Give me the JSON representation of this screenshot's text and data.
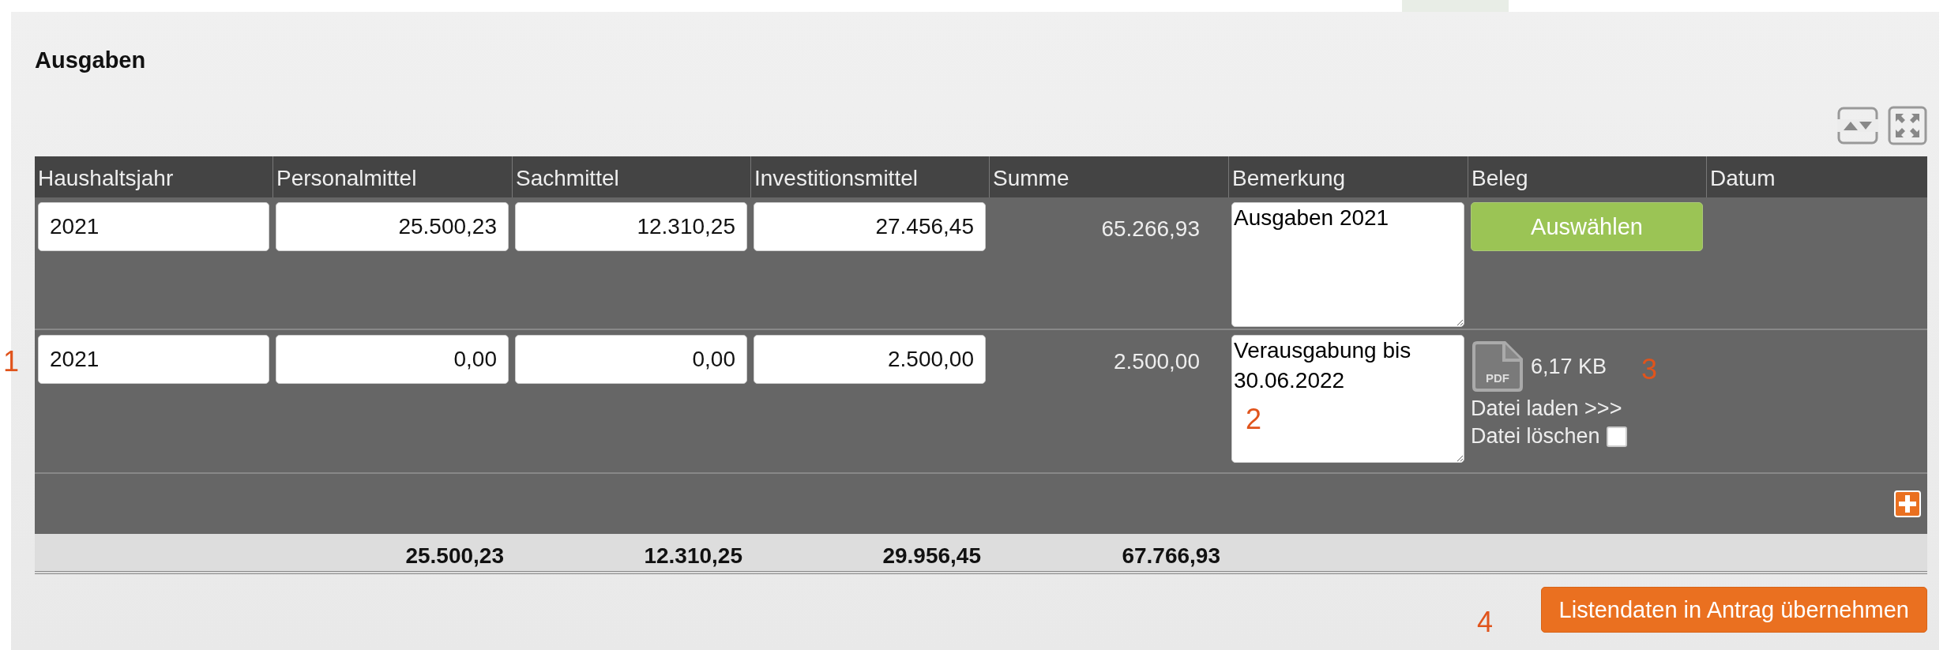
{
  "title": "Ausgaben",
  "table": {
    "columns": [
      "Haushaltsjahr",
      "Personalmittel",
      "Sachmittel",
      "Investitionsmittel",
      "Summe",
      "Bemerkung",
      "Beleg",
      "Datum"
    ],
    "rows": [
      {
        "fiscal_year": "2021",
        "personnel": "25.500,23",
        "material": "12.310,25",
        "investment": "27.456,45",
        "sum": "65.266,93",
        "remark": "Ausgaben 2021",
        "receipt": {
          "kind": "button",
          "label": "Auswählen"
        }
      },
      {
        "fiscal_year": "2021",
        "personnel": "0,00",
        "material": "0,00",
        "investment": "2.500,00",
        "sum": "2.500,00",
        "remark": "Verausgabung bis 30.06.2022",
        "receipt": {
          "kind": "file",
          "icon_label": "PDF",
          "size": "6,17 KB",
          "load_link": "Datei laden >>>",
          "delete_label": "Datei löschen",
          "delete_checked": false
        }
      }
    ],
    "totals": [
      "25.500,23",
      "12.310,25",
      "29.956,45",
      "67.766,93"
    ]
  },
  "submit_button": "Listendaten in Antrag übernehmen",
  "callouts": [
    {
      "label": "1"
    },
    {
      "label": "2"
    },
    {
      "label": "3"
    },
    {
      "label": "4"
    }
  ]
}
